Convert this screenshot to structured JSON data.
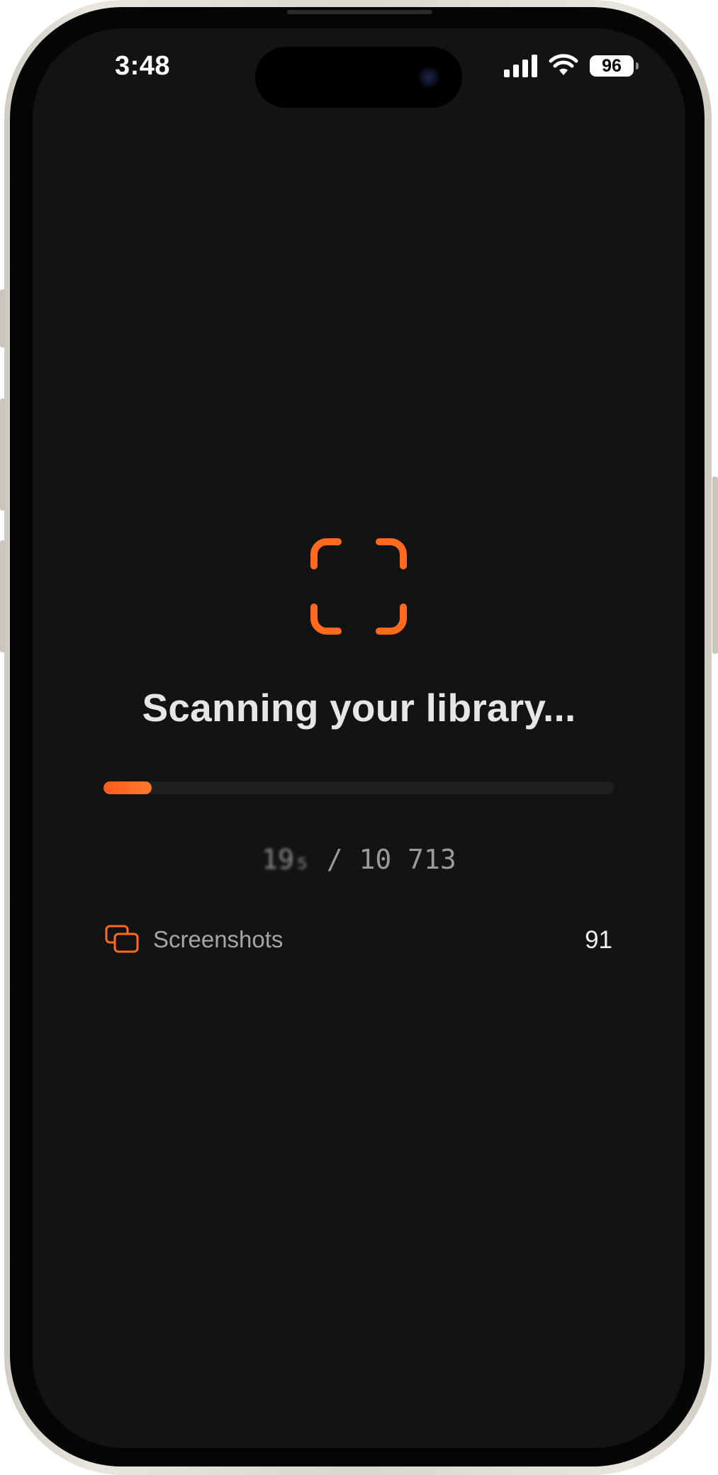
{
  "status_bar": {
    "time": "3:48",
    "battery_level": "96",
    "icons": [
      "cellular-signal-icon",
      "wifi-icon",
      "battery-icon"
    ]
  },
  "scan": {
    "icon": "scan-frame-icon",
    "title": "Scanning your library...",
    "progress_fraction": 0.095,
    "current_count": "19₅",
    "separator": "/",
    "total_count": "10 713"
  },
  "categories": [
    {
      "icon": "screenshots-icon",
      "label": "Screenshots",
      "count": "91"
    }
  ],
  "colors": {
    "accent": "#ff6a1f",
    "background": "#131313",
    "text_primary": "#e6e6e6",
    "text_secondary": "#a6a6a6"
  }
}
